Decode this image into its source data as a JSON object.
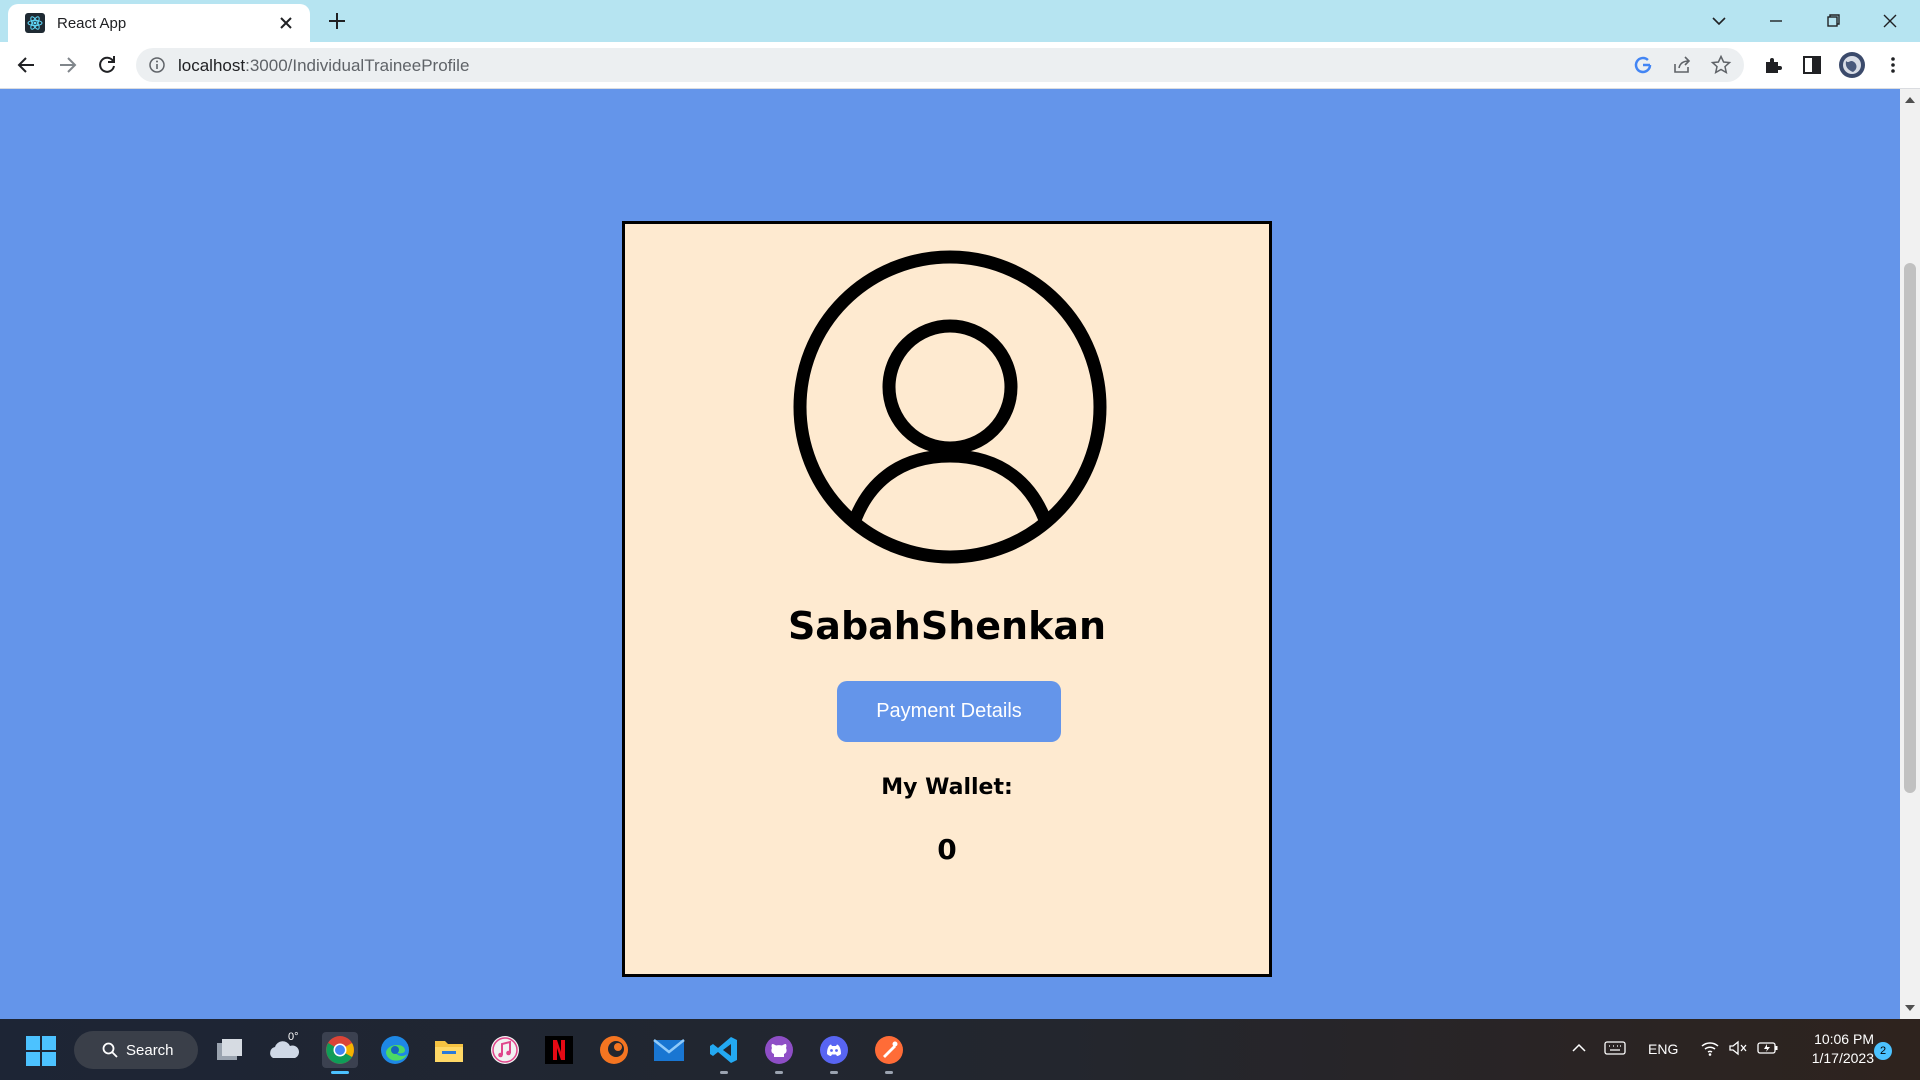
{
  "browser": {
    "tab_title": "React App",
    "url_host": "localhost",
    "url_rest": ":3000/IndividualTraineeProfile"
  },
  "page": {
    "username": "SabahShenkan",
    "payment_button_label": "Payment Details",
    "wallet_label": "My Wallet:",
    "wallet_value": "0"
  },
  "taskbar": {
    "search_label": "Search",
    "weather_temp": "0°",
    "language": "ENG",
    "time": "10:06 PM",
    "date": "1/17/2023",
    "notification_count": "2"
  },
  "colors": {
    "page_background": "#6495ea",
    "card_background": "#feead0",
    "button_background": "#6495ea"
  }
}
